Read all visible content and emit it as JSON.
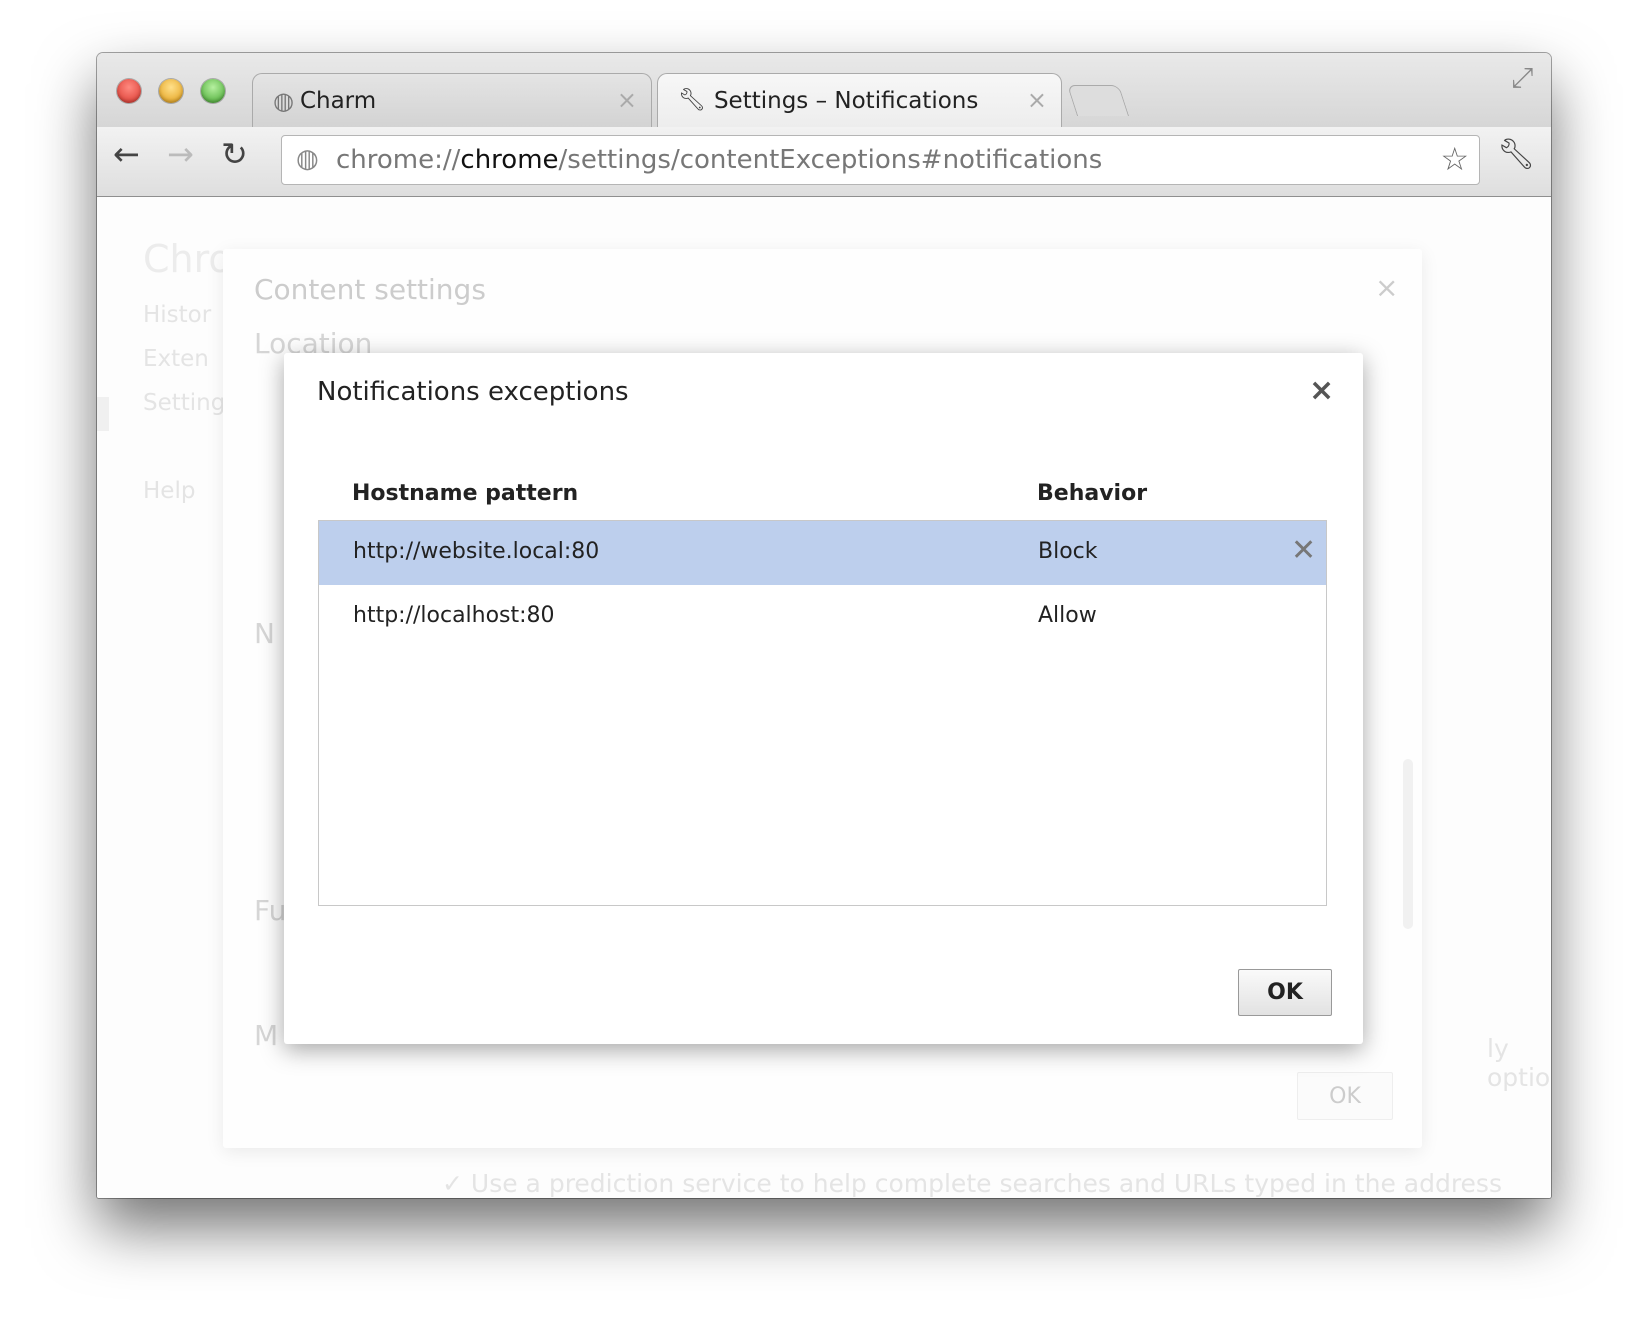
{
  "window": {
    "tabs": [
      {
        "label": "Charm",
        "icon": "globe-icon"
      },
      {
        "label": "Settings – Notifications",
        "icon": "wrench-icon"
      }
    ],
    "address": {
      "scheme": "chrome://",
      "host": "chrome",
      "path": "/settings/contentExceptions#notifications"
    }
  },
  "background": {
    "page_title": "Chro",
    "nav": [
      "Histor",
      "Exten",
      "Setting",
      "Help"
    ],
    "fragments": {
      "no": "N",
      "fu": "Fu",
      "m": "M",
      "optional": "ly optional",
      "prediction": "Use a prediction service to help complete searches and URLs typed in the address bar"
    }
  },
  "content_dialog": {
    "title": "Content settings",
    "section": "Location",
    "close": "×",
    "ok": "OK"
  },
  "notifications_dialog": {
    "title": "Notifications exceptions",
    "close": "×",
    "columns": [
      "Hostname pattern",
      "Behavior"
    ],
    "rows": [
      {
        "pattern": "http://website.local:80",
        "behavior": "Block",
        "selected": true
      },
      {
        "pattern": "http://localhost:80",
        "behavior": "Allow",
        "selected": false
      }
    ],
    "ok": "OK"
  },
  "colors": {
    "selection": "#bdcfed",
    "close_red": "#ec4c45",
    "min_yellow": "#f3b52a",
    "max_green": "#5fc044"
  }
}
